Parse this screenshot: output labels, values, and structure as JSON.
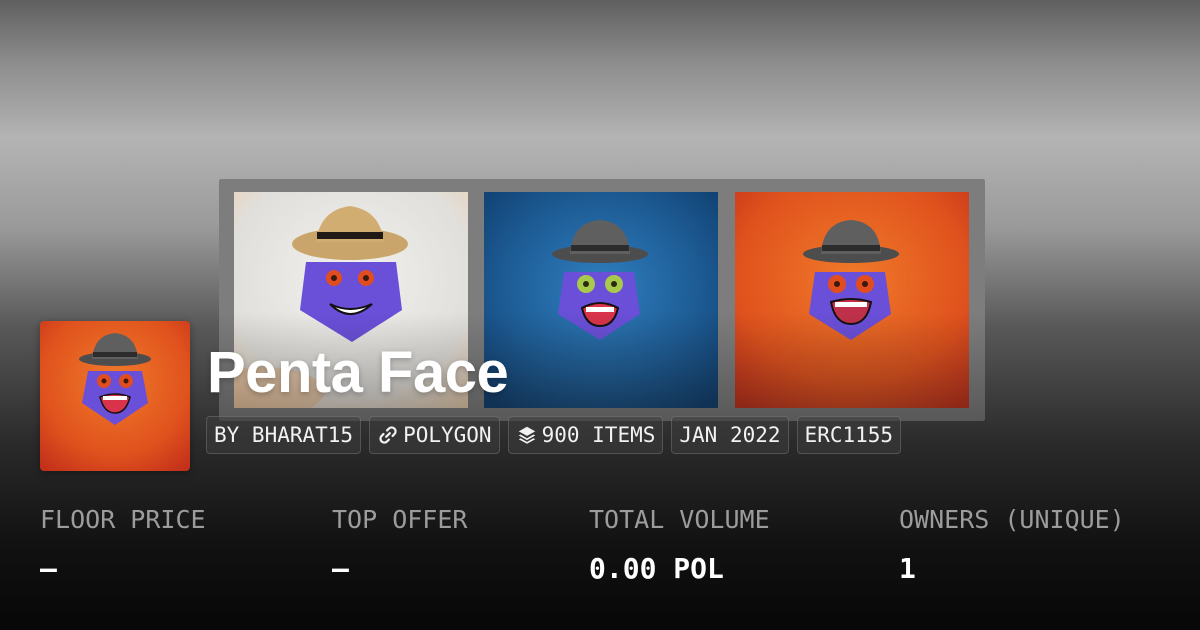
{
  "collection": {
    "title": "Penta Face",
    "chips": {
      "creator": "BY BHARAT15",
      "chain": "POLYGON",
      "items": "900 ITEMS",
      "date": "JAN 2022",
      "standard": "ERC1155"
    }
  },
  "stats": [
    {
      "label": "FLOOR PRICE",
      "value": "–"
    },
    {
      "label": "TOP OFFER",
      "value": "–"
    },
    {
      "label": "TOTAL VOLUME",
      "value": "0.00 POL"
    },
    {
      "label": "OWNERS (UNIQUE)",
      "value": "1"
    }
  ],
  "icons": {
    "chain": "link-icon",
    "items": "layers-icon"
  },
  "colors": {
    "face": "#6a4fd8",
    "art1_bg": "#e6e4e0",
    "art2_bg": "#1d5b94",
    "art3_bg": "#e0521d"
  }
}
